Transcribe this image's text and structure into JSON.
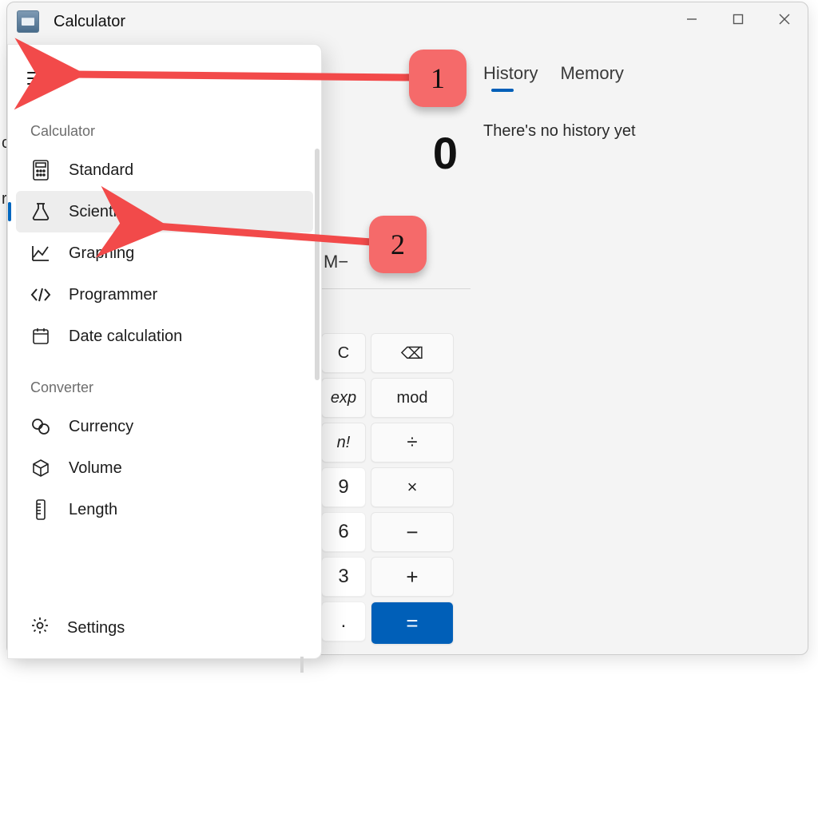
{
  "window": {
    "title": "Calculator"
  },
  "nav": {
    "section_calc": "Calculator",
    "section_conv": "Converter",
    "items_calc": [
      {
        "label": "Standard"
      },
      {
        "label": "Scientific"
      },
      {
        "label": "Graphing"
      },
      {
        "label": "Programmer"
      },
      {
        "label": "Date calculation"
      }
    ],
    "items_conv": [
      {
        "label": "Currency"
      },
      {
        "label": "Volume"
      },
      {
        "label": "Length"
      }
    ],
    "settings": "Settings"
  },
  "display": {
    "value": "0"
  },
  "memory_row": {
    "m_minus": "M−"
  },
  "keys": {
    "c": "C",
    "bksp": "⌫",
    "exp": "exp",
    "mod": "mod",
    "fact": "n!",
    "div": "÷",
    "k9": "9",
    "mul": "×",
    "k6": "6",
    "sub": "−",
    "k3": "3",
    "add": "+",
    "dot": ".",
    "eq": "="
  },
  "tabs": {
    "history": "History",
    "memory": "Memory"
  },
  "history_empty": "There's no history yet",
  "markers": {
    "one": "1",
    "two": "2"
  },
  "behind": {
    "t1": "cc",
    "t2": "re"
  }
}
